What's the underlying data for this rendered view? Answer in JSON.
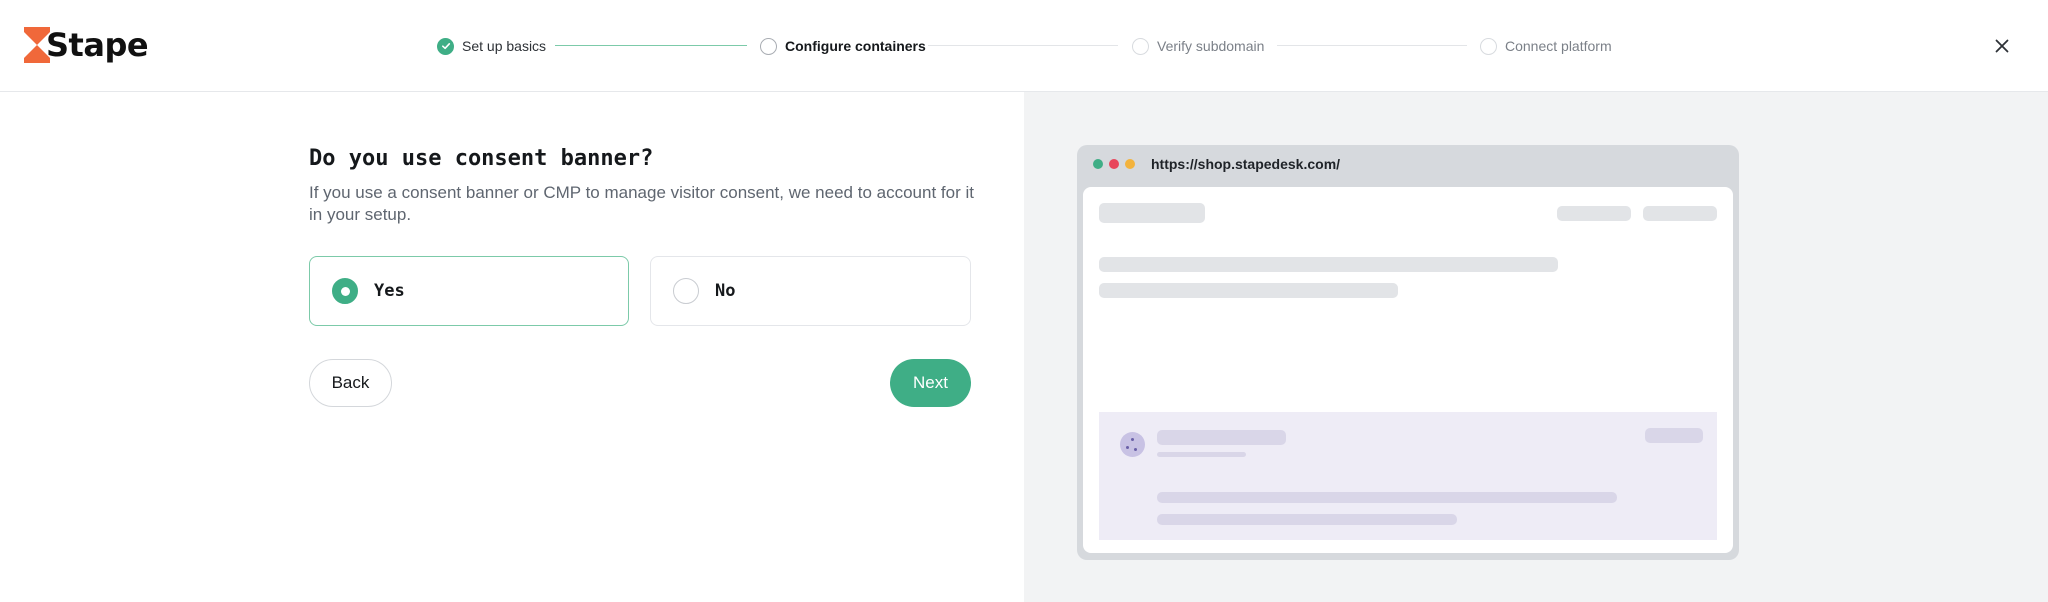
{
  "app": {
    "logo_text": "Stape",
    "brand_color": "#3fae86",
    "logo_accent": "#f0683a"
  },
  "stepper": {
    "steps": [
      {
        "label": "Set up basics",
        "state": "done"
      },
      {
        "label": "Configure containers",
        "state": "active"
      },
      {
        "label": "Verify subdomain",
        "state": "todo"
      },
      {
        "label": "Connect platform",
        "state": "todo"
      }
    ]
  },
  "icons": {
    "close": "close-icon",
    "check": "check-icon",
    "cookie": "cookie-icon"
  },
  "form": {
    "question": "Do you use consent banner?",
    "description": "If you use a consent banner or CMP to manage visitor consent, we need to account for it in your setup.",
    "options": [
      {
        "label": "Yes",
        "selected": true
      },
      {
        "label": "No",
        "selected": false
      }
    ],
    "back_label": "Back",
    "next_label": "Next"
  },
  "preview": {
    "url": "https://shop.stapedesk.com/",
    "window_dots": [
      "#3fae86",
      "#e8455b",
      "#f3b33d"
    ]
  }
}
